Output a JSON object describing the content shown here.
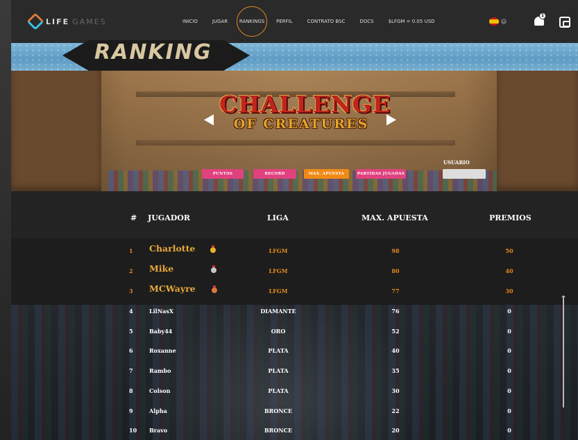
{
  "nav": {
    "logo_main": "LIFE",
    "logo_sub": "GAMES",
    "items": [
      {
        "label": "INICIO",
        "active": false
      },
      {
        "label": "JUGAR",
        "active": false
      },
      {
        "label": "RANKINGS",
        "active": true
      },
      {
        "label": "PERFIL",
        "active": false
      },
      {
        "label": "CONTRATO BSC",
        "active": false
      },
      {
        "label": "DOCS",
        "active": false
      },
      {
        "label": "$LFGM = 0.05 USD",
        "active": false
      }
    ],
    "notification_count": "1",
    "language_icon": "spain-flag-icon"
  },
  "banner": {
    "title": "RANKING"
  },
  "game": {
    "title_line1": "CHALLENGE",
    "title_line2": "OF CREATURES"
  },
  "filters": [
    {
      "label": "PUNTOS",
      "color": "#e0417f"
    },
    {
      "label": "RECORD",
      "color": "#e0417f"
    },
    {
      "label": "MAX. APUESTA",
      "color": "#f08a16"
    },
    {
      "label": "PARTIDAS JUGADAS",
      "color": "#e0417f"
    }
  ],
  "user_filter": {
    "label": "USUARIO",
    "value": "",
    "placeholder": ""
  },
  "table": {
    "headers": {
      "rank": "#",
      "player": "JUGADOR",
      "league": "LIGA",
      "bet": "MAX. APUESTA",
      "prizes": "PREMIOS"
    },
    "rows": [
      {
        "rank": "1",
        "player": "Charlotte",
        "league": "LFGM",
        "bet": "98",
        "prize": "50",
        "medal": "gold"
      },
      {
        "rank": "2",
        "player": "Mike",
        "league": "LFGM",
        "bet": "80",
        "prize": "40",
        "medal": "silver"
      },
      {
        "rank": "3",
        "player": "MCWayre",
        "league": "LFGM",
        "bet": "77",
        "prize": "30",
        "medal": "bronze"
      },
      {
        "rank": "4",
        "player": "LilNasX",
        "league": "DIAMANTE",
        "bet": "76",
        "prize": "0"
      },
      {
        "rank": "5",
        "player": "Baby44",
        "league": "ORO",
        "bet": "52",
        "prize": "0"
      },
      {
        "rank": "6",
        "player": "Roxanne",
        "league": "PLATA",
        "bet": "40",
        "prize": "0"
      },
      {
        "rank": "7",
        "player": "Rambo",
        "league": "PLATA",
        "bet": "35",
        "prize": "0"
      },
      {
        "rank": "8",
        "player": "Colson",
        "league": "PLATA",
        "bet": "30",
        "prize": "0"
      },
      {
        "rank": "9",
        "player": "Alpha",
        "league": "BRONCE",
        "bet": "22",
        "prize": "0"
      },
      {
        "rank": "10",
        "player": "Bravo",
        "league": "BRONCE",
        "bet": "20",
        "prize": "0"
      }
    ]
  },
  "colors": {
    "accent": "#e58a1f",
    "gold_text": "#e8a93a",
    "pink": "#e0417f",
    "orange": "#f08a16"
  }
}
